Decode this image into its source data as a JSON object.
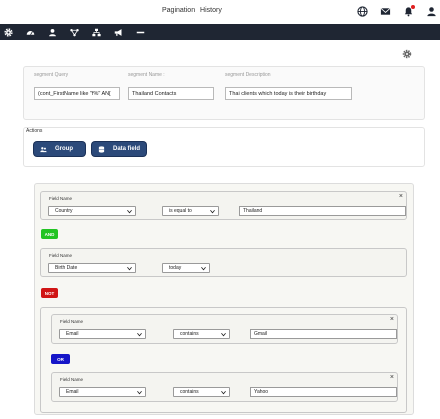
{
  "topbar": {
    "link_pagination": "Pagination",
    "link_history": "History",
    "icons": [
      "globe-icon",
      "mail-icon",
      "bell-icon",
      "user-icon"
    ]
  },
  "navbar": {
    "icons": [
      "gear-icon",
      "dashboard-icon",
      "user-icon",
      "network-icon",
      "hierarchy-icon",
      "megaphone-icon",
      "minus-icon"
    ]
  },
  "segment": {
    "query_label": "segment Query",
    "query_value": "(cont_FirstName like \"f%\" AN[",
    "name_label": "segment Name :",
    "name_value": "Thailand Contacts",
    "description_label": "segment Description",
    "description_value": "Thai clients which today is their birthday"
  },
  "actions": {
    "label": "Actions",
    "group_button": "Group",
    "data_field_button": "Data field"
  },
  "conditions": [
    {
      "field_name_label": "Field Name",
      "field": "Country",
      "operator": "is equal to",
      "value": "Thailand"
    },
    {
      "field_name_label": "Field Name",
      "field": "Birth Date",
      "operator": "today"
    },
    {
      "field_name_label": "Field Name",
      "field": "Email",
      "operator": "contains",
      "value": "Gmail"
    },
    {
      "field_name_label": "Field Name",
      "field": "Email",
      "operator": "contains",
      "value": "Yahoo"
    }
  ],
  "logic_ops": {
    "and": "AND",
    "not": "NOT",
    "or": "OR"
  },
  "colors": {
    "navbar": "#1f2633",
    "and": "#22c422",
    "not": "#d01515",
    "or": "#1515c8",
    "button": "#2c4a7a"
  },
  "close_symbol": "×"
}
